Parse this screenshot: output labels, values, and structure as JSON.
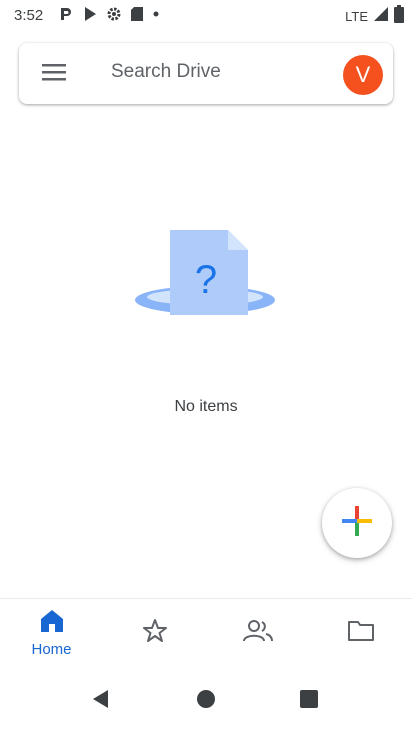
{
  "status_bar": {
    "time": "3:52",
    "network": "LTE"
  },
  "search": {
    "placeholder": "Search Drive"
  },
  "account": {
    "initial": "V",
    "color": "#f4511e"
  },
  "empty_state": {
    "message": "No items",
    "illustration": "file-question-icon"
  },
  "fab": {
    "icon": "plus-icon"
  },
  "bottom_nav": {
    "items": [
      {
        "icon": "home-icon",
        "label": "Home",
        "active": true
      },
      {
        "icon": "star-icon",
        "label": "",
        "active": false
      },
      {
        "icon": "shared-people-icon",
        "label": "",
        "active": false
      },
      {
        "icon": "folder-icon",
        "label": "",
        "active": false
      }
    ]
  },
  "colors": {
    "accent": "#1967d2",
    "illustration_blue": "#8ab4f8"
  }
}
